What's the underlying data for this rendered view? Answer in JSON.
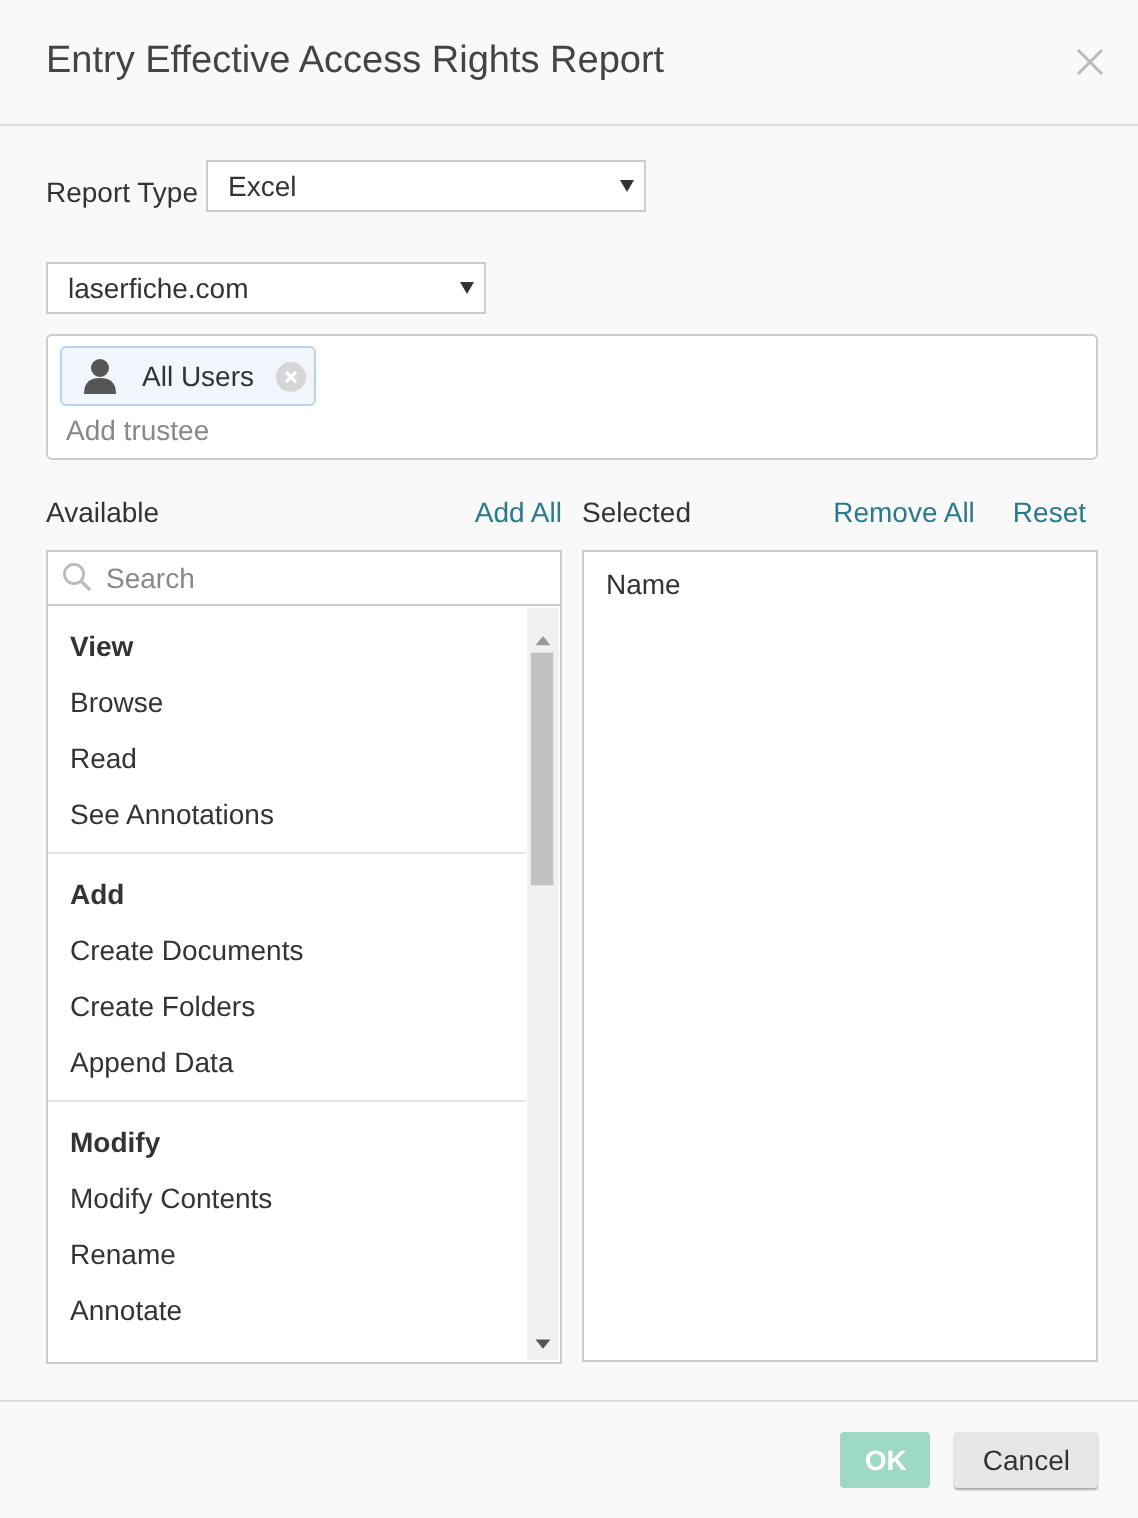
{
  "window": {
    "title": "Entry Effective Access Rights Report"
  },
  "report_type": {
    "label": "Report Type",
    "value": "Excel"
  },
  "domain": {
    "value": "laserfiche.com"
  },
  "trustees": {
    "tokens": [
      {
        "label": "All Users"
      }
    ],
    "placeholder": "Add trustee"
  },
  "available": {
    "label": "Available",
    "action": "Add All",
    "search_placeholder": "Search",
    "groups": [
      {
        "title": "View",
        "items": [
          "Browse",
          "Read",
          "See Annotations"
        ]
      },
      {
        "title": "Add",
        "items": [
          "Create Documents",
          "Create Folders",
          "Append Data"
        ]
      },
      {
        "title": "Modify",
        "items": [
          "Modify Contents",
          "Rename",
          "Annotate"
        ]
      }
    ]
  },
  "selected": {
    "label": "Selected",
    "actions": [
      "Remove All",
      "Reset"
    ],
    "column": "Name"
  },
  "buttons": [
    {
      "label": "OK",
      "kind": "primary",
      "disabled": true
    },
    {
      "label": "Cancel",
      "kind": "secondary",
      "disabled": false
    }
  ]
}
